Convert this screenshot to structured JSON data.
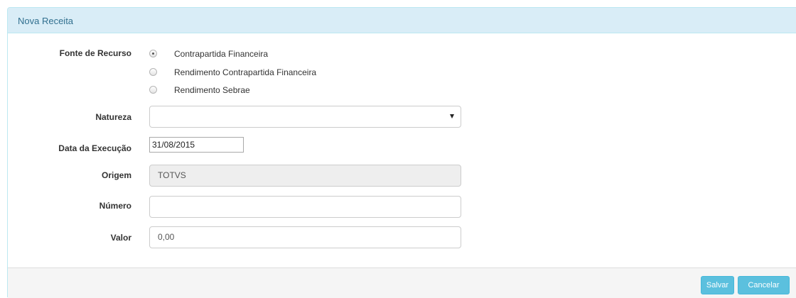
{
  "panel": {
    "title": "Nova Receita"
  },
  "fonte_recurso": {
    "label": "Fonte de Recurso",
    "options": [
      {
        "label": "Contrapartida Financeira",
        "checked": true
      },
      {
        "label": "Rendimento Contrapartida Financeira",
        "checked": false
      },
      {
        "label": "Rendimento Sebrae",
        "checked": false
      }
    ]
  },
  "natureza": {
    "label": "Natureza",
    "value": ""
  },
  "data_execucao": {
    "label": "Data da Execução",
    "value": "31/08/2015"
  },
  "origem": {
    "label": "Origem",
    "value": "TOTVS"
  },
  "numero": {
    "label": "Número",
    "value": ""
  },
  "valor": {
    "label": "Valor",
    "value": "0,00"
  },
  "footer": {
    "save_label": "Salvar",
    "cancel_label": "Cancelar"
  },
  "colors": {
    "accent": "#5bc0de",
    "heading_bg": "#d9edf7",
    "heading_text": "#31708f"
  }
}
